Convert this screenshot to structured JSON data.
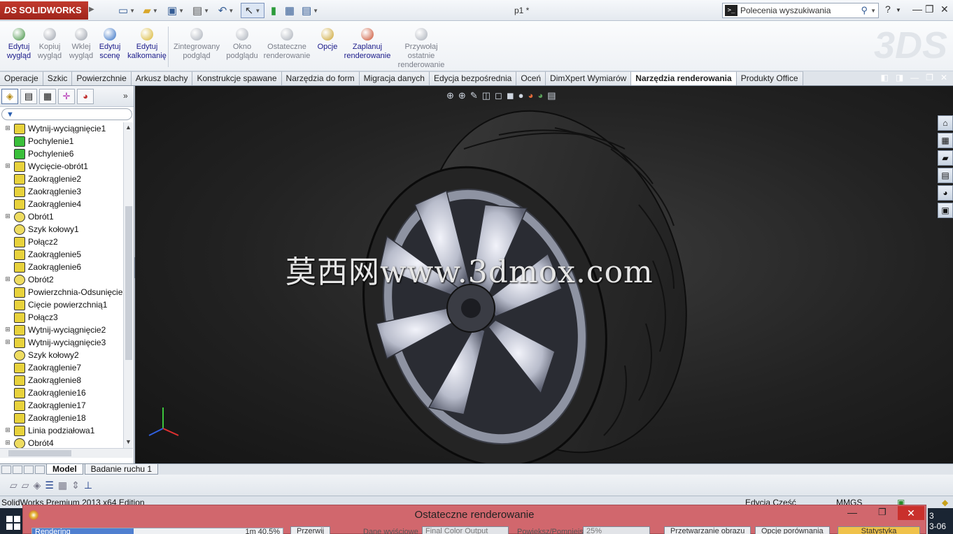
{
  "app": {
    "logo_text": "SOLIDWORKS",
    "logo_ds": "DS",
    "document_title": "p1 *",
    "search_placeholder": "Polecenia wyszukiwania",
    "help_glyph": "?"
  },
  "ribbon": {
    "buttons": [
      {
        "label": "Edytuj\nwygląd",
        "icon": "appearance-icon",
        "enabled": true
      },
      {
        "label": "Kopiuj\nwygląd",
        "icon": "copy-appearance-icon",
        "enabled": false
      },
      {
        "label": "Wklej\nwygląd",
        "icon": "paste-appearance-icon",
        "enabled": false
      },
      {
        "label": "Edytuj\nscenę",
        "icon": "scene-icon",
        "enabled": true
      },
      {
        "label": "Edytuj\nkalkomanię",
        "icon": "decal-icon",
        "enabled": true
      },
      {
        "label": "Zintegrowany\npodgląd",
        "icon": "integrated-preview-icon",
        "enabled": false
      },
      {
        "label": "Okno\npodglądu",
        "icon": "preview-window-icon",
        "enabled": false
      },
      {
        "label": "Ostateczne\nrenderowanie",
        "icon": "final-render-icon",
        "enabled": false
      },
      {
        "label": "Opcje",
        "icon": "options-icon",
        "enabled": true
      },
      {
        "label": "Zaplanuj\nrenderowanie",
        "icon": "schedule-render-icon",
        "enabled": true
      },
      {
        "label": "Przywołaj\nostatnie\nrenderowanie",
        "icon": "recall-render-icon",
        "enabled": false
      }
    ]
  },
  "tabs": [
    {
      "label": "Operacje",
      "active": false
    },
    {
      "label": "Szkic",
      "active": false
    },
    {
      "label": "Powierzchnie",
      "active": false
    },
    {
      "label": "Arkusz blachy",
      "active": false
    },
    {
      "label": "Konstrukcje spawane",
      "active": false
    },
    {
      "label": "Narzędzia do form",
      "active": false
    },
    {
      "label": "Migracja danych",
      "active": false
    },
    {
      "label": "Edycja bezpośrednia",
      "active": false
    },
    {
      "label": "Oceń",
      "active": false
    },
    {
      "label": "DimXpert Wymiarów",
      "active": false
    },
    {
      "label": "Narzędzia renderowania",
      "active": true
    },
    {
      "label": "Produkty Office",
      "active": false
    }
  ],
  "tree": [
    {
      "label": "Wytnij-wyciągnięcie1",
      "expandable": true,
      "icon": "cut-extrude-icon"
    },
    {
      "label": "Pochylenie1",
      "expandable": false,
      "icon": "draft-icon"
    },
    {
      "label": "Pochylenie6",
      "expandable": false,
      "icon": "draft-icon"
    },
    {
      "label": "Wycięcie-obrót1",
      "expandable": true,
      "icon": "cut-revolve-icon"
    },
    {
      "label": "Zaokrąglenie2",
      "expandable": false,
      "icon": "fillet-icon"
    },
    {
      "label": "Zaokrąglenie3",
      "expandable": false,
      "icon": "fillet-icon"
    },
    {
      "label": "Zaokrąglenie4",
      "expandable": false,
      "icon": "fillet-icon"
    },
    {
      "label": "Obrót1",
      "expandable": true,
      "icon": "revolve-icon"
    },
    {
      "label": "Szyk kołowy1",
      "expandable": false,
      "icon": "circular-pattern-icon"
    },
    {
      "label": "Połącz2",
      "expandable": false,
      "icon": "combine-icon"
    },
    {
      "label": "Zaokrąglenie5",
      "expandable": false,
      "icon": "fillet-icon"
    },
    {
      "label": "Zaokrąglenie6",
      "expandable": false,
      "icon": "fillet-icon"
    },
    {
      "label": "Obrót2",
      "expandable": true,
      "icon": "revolve-icon"
    },
    {
      "label": "Powierzchnia-Odsunięcie",
      "expandable": false,
      "icon": "offset-surface-icon"
    },
    {
      "label": "Cięcie powierzchnią1",
      "expandable": false,
      "icon": "surface-cut-icon"
    },
    {
      "label": "Połącz3",
      "expandable": false,
      "icon": "combine-icon"
    },
    {
      "label": "Wytnij-wyciągnięcie2",
      "expandable": true,
      "icon": "cut-extrude-icon"
    },
    {
      "label": "Wytnij-wyciągnięcie3",
      "expandable": true,
      "icon": "cut-extrude-icon"
    },
    {
      "label": "Szyk kołowy2",
      "expandable": false,
      "icon": "circular-pattern-icon"
    },
    {
      "label": "Zaokrąglenie7",
      "expandable": false,
      "icon": "fillet-icon"
    },
    {
      "label": "Zaokrąglenie8",
      "expandable": false,
      "icon": "fillet-icon"
    },
    {
      "label": "Zaokrąglenie16",
      "expandable": false,
      "icon": "fillet-icon"
    },
    {
      "label": "Zaokrąglenie17",
      "expandable": false,
      "icon": "fillet-icon"
    },
    {
      "label": "Zaokrąglenie18",
      "expandable": false,
      "icon": "fillet-icon"
    },
    {
      "label": "Linia podziałowa1",
      "expandable": true,
      "icon": "split-line-icon"
    },
    {
      "label": "Obrót4",
      "expandable": true,
      "icon": "revolve-icon"
    }
  ],
  "viewport": {
    "watermark": "莫西网www.3dmox.com"
  },
  "bottom_tabs": [
    {
      "label": "Model",
      "active": true
    },
    {
      "label": "Badanie ruchu 1",
      "active": false
    }
  ],
  "status": {
    "edition": "SolidWorks Premium 2013 x64 Edition",
    "mode": "Edycja Część",
    "units": "MMGS"
  },
  "render_dialog": {
    "title": "Ostateczne renderowanie",
    "progress_label": "Rendering",
    "progress_time": "1m",
    "progress_percent": "40.5%",
    "progress_value": 0.405,
    "button_pause": "Przerwij",
    "output_label": "Dane wyjściowe",
    "output_value": "Final Color Output",
    "zoom_label": "Powiększ/Pomniejsz",
    "zoom_value": "25%",
    "button_process": "Przetwarzanie obrazu",
    "button_compare": "Opcje porównania",
    "button_stats": "Statystyka"
  },
  "taskbar": {
    "clock_line1": "3",
    "clock_line2": "3-06"
  },
  "colors": {
    "accent": "#c23a2e",
    "ribbon_text": "#1b1b8a",
    "dialog_bg": "#d1676d"
  }
}
